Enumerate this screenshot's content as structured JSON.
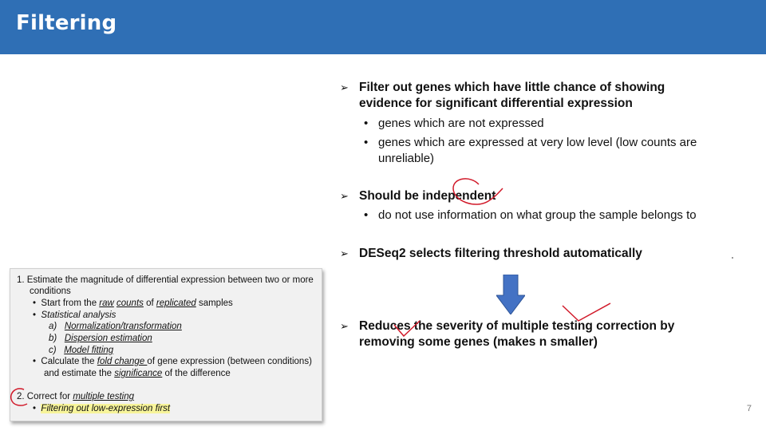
{
  "header": {
    "title": "Filtering",
    "bg_color": "#2f6fb5"
  },
  "bullets": [
    {
      "text_line1": "Filter out genes which have little chance of showing",
      "text_line2": "evidence for significant differential expression",
      "subs": [
        {
          "line1": "genes which are not expressed",
          "line2": ""
        },
        {
          "line1": "genes which are expressed at very low level (low counts are",
          "line2": "unreliable)"
        }
      ]
    },
    {
      "text_line1": "Should be independent",
      "text_line2": "",
      "subs": [
        {
          "line1": "do not use information on what group the sample belongs to",
          "line2": ""
        }
      ]
    },
    {
      "text_line1": "DESeq2 selects filtering threshold automatically",
      "text_line2": "",
      "subs": []
    },
    {
      "text_line1": "Reduces the severity of multiple testing correction by",
      "text_line2": "removing some genes (makes n smaller)",
      "subs": []
    }
  ],
  "arrow_glyph": "➢",
  "bullet_glyph": "•",
  "arrow_color": "#4472c4",
  "annotation_color": "#d11a2a",
  "box": {
    "l1a": "1.  Estimate the magnitude of differential expression between two or more",
    "l1b": "conditions",
    "l2a": "Start from the ",
    "l2b": "raw",
    "l2c": "counts",
    "l2d": " of ",
    "l2e": "replicated",
    "l2f": " samples",
    "l3": "Statistical analysis",
    "l4a": "a)",
    "l4b": "Normalization/transformation",
    "l5a": "b)",
    "l5b": "Dispersion estimation",
    "l6a": "c)",
    "l6b": "Model fitting",
    "l7a": "Calculate the ",
    "l7b": "fold change ",
    "l7c": "of gene expression (between conditions)",
    "l8a": "and estimate the ",
    "l8b": "significance",
    "l8c": " of the difference",
    "l9a": "2.",
    "l9b": " Correct for ",
    "l9c": "multiple testing",
    "l10a": "Filtering out low-expression first",
    "bullet": "•"
  },
  "page_number": "7"
}
